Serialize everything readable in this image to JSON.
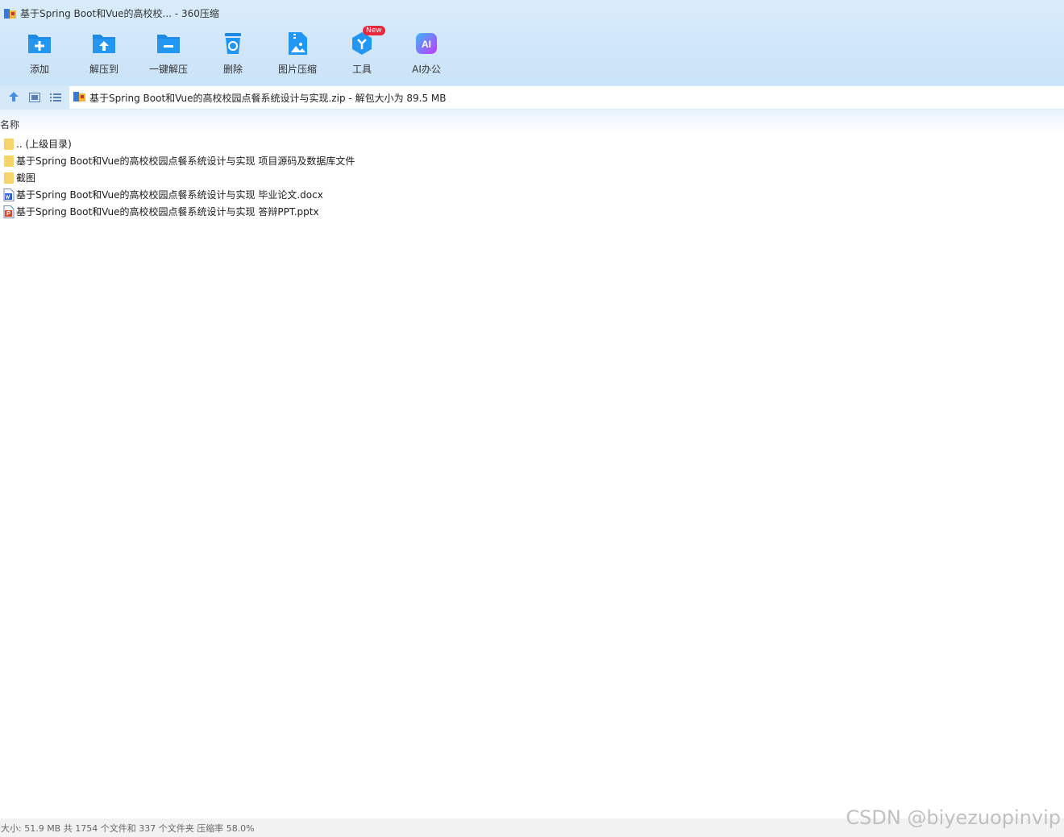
{
  "window": {
    "title": "基于Spring Boot和Vue的高校校... - 360压缩"
  },
  "toolbar": {
    "buttons": [
      {
        "label": "添加",
        "icon": "add-icon"
      },
      {
        "label": "解压到",
        "icon": "extract-to-icon"
      },
      {
        "label": "一键解压",
        "icon": "one-click-extract-icon"
      },
      {
        "label": "删除",
        "icon": "delete-icon"
      },
      {
        "label": "图片压缩",
        "icon": "image-compress-icon"
      },
      {
        "label": "工具",
        "icon": "tools-icon"
      },
      {
        "label": "AI办公",
        "icon": "ai-office-icon"
      }
    ],
    "new_badge": "New",
    "ai_icon_text": "AI"
  },
  "addressbar": {
    "path": "基于Spring Boot和Vue的高校校园点餐系统设计与实现.zip - 解包大小为 89.5 MB"
  },
  "filelist": {
    "column_name": "名称",
    "rows": [
      {
        "name": ".. (上级目录)",
        "type": "folder"
      },
      {
        "name": "基于Spring Boot和Vue的高校校园点餐系统设计与实现 项目源码及数据库文件",
        "type": "folder"
      },
      {
        "name": "截图",
        "type": "folder"
      },
      {
        "name": "基于Spring Boot和Vue的高校校园点餐系统设计与实现 毕业论文.docx",
        "type": "docx"
      },
      {
        "name": "基于Spring Boot和Vue的高校校园点餐系统设计与实现 答辩PPT.pptx",
        "type": "pptx"
      }
    ]
  },
  "statusbar": {
    "text": "大小: 51.9 MB 共 1754 个文件和 337 个文件夹 压缩率 58.0%"
  },
  "watermark": "CSDN @biyezuopinvip",
  "colors": {
    "accent": "#1e88e5",
    "folder": "#f7d46a",
    "badge": "#e8283c"
  }
}
